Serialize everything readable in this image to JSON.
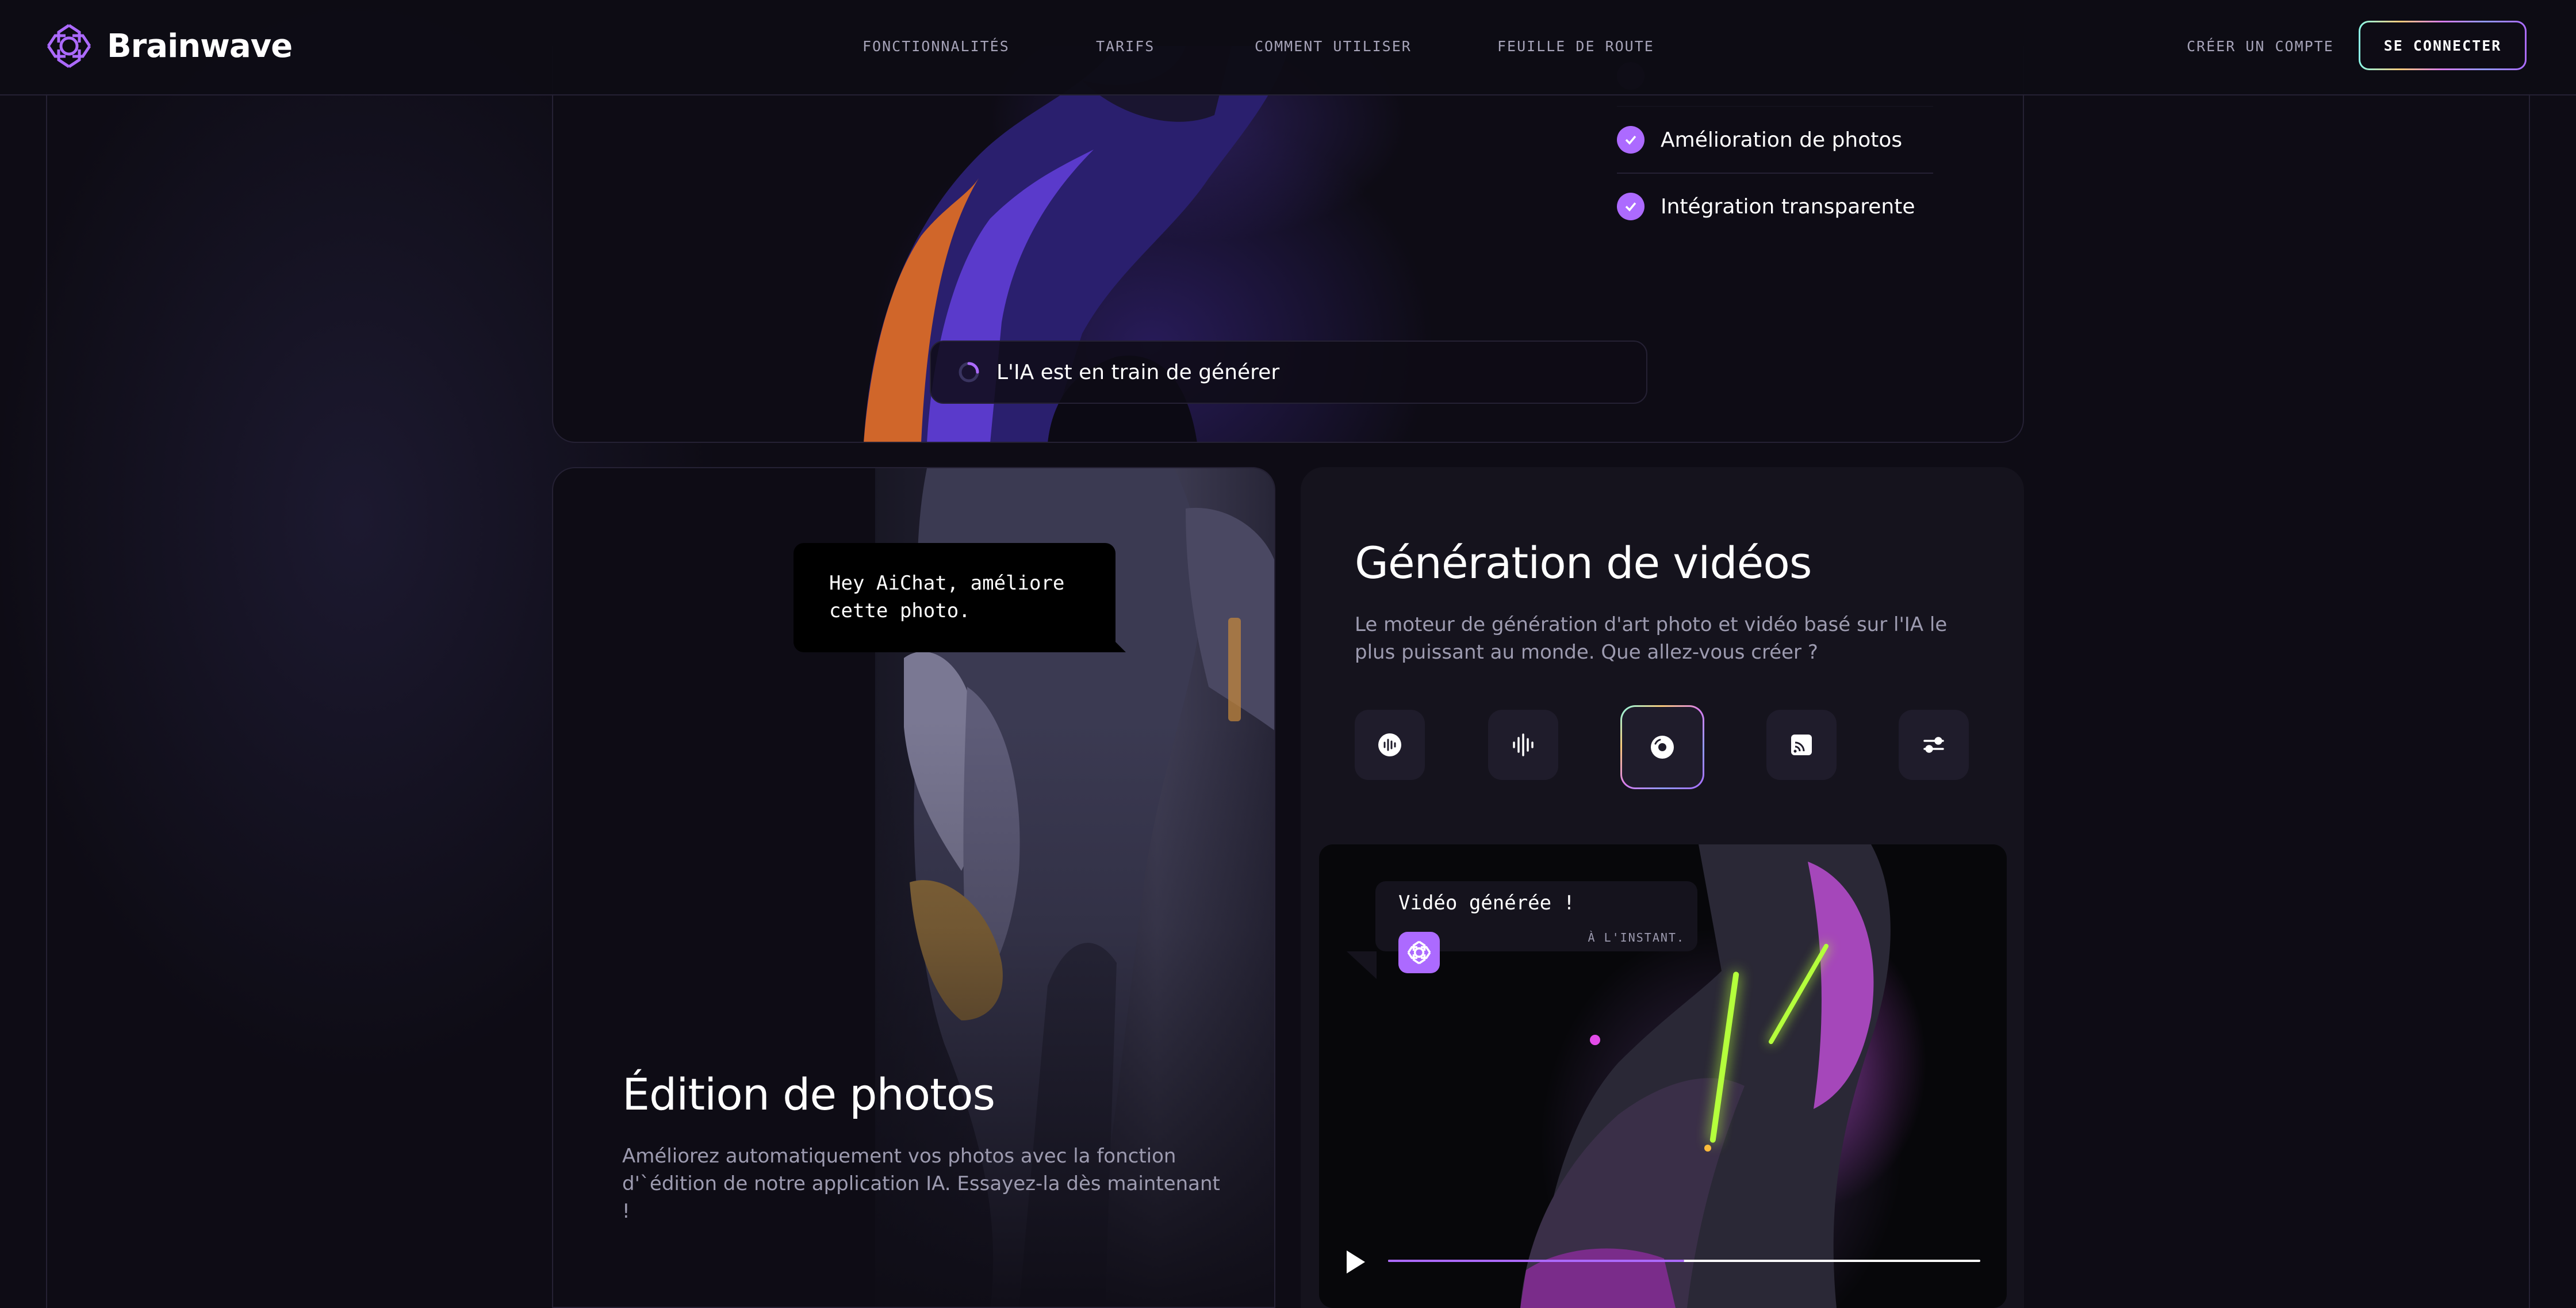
{
  "header": {
    "brand": "Brainwave",
    "nav": [
      "FONCTIONNALITÉS",
      "TARIFS",
      "COMMENT UTILISER",
      "FEUILLE DE ROUTE"
    ],
    "signup_label": "CRÉER UN COMPTE",
    "login_label": "SE CONNECTER"
  },
  "hero": {
    "checklist": [
      "Amélioration de photos",
      "Intégration transparente"
    ],
    "generating_text": "L'IA est en train de générer"
  },
  "photo_editing": {
    "prompt_bubble": "Hey AiChat, améliore cette photo.",
    "title": "Édition de photos",
    "description": "Améliorez automatiquement vos photos avec la fonction d'`édition de notre application IA. Essayez-la dès maintenant !"
  },
  "video_generation": {
    "title": "Génération de vidéos",
    "description": "Le moteur de génération d'art photo et vidéo basé sur l'IA le plus puissant au monde. Que allez-vous créer ?",
    "tools": [
      {
        "icon": "recording-icon",
        "active": false
      },
      {
        "icon": "sound-wave-icon",
        "active": false
      },
      {
        "icon": "disc-icon",
        "active": true
      },
      {
        "icon": "cast-icon",
        "active": false
      },
      {
        "icon": "sliders-icon",
        "active": false
      }
    ],
    "notification": {
      "text": "Vidéo générée !",
      "time": "À L'INSTANT."
    },
    "progress": 0.5
  },
  "colors": {
    "accent": "#ac6aff",
    "background": "#0e0c15",
    "card": "#15131d",
    "neon": "#b4ff3c"
  }
}
